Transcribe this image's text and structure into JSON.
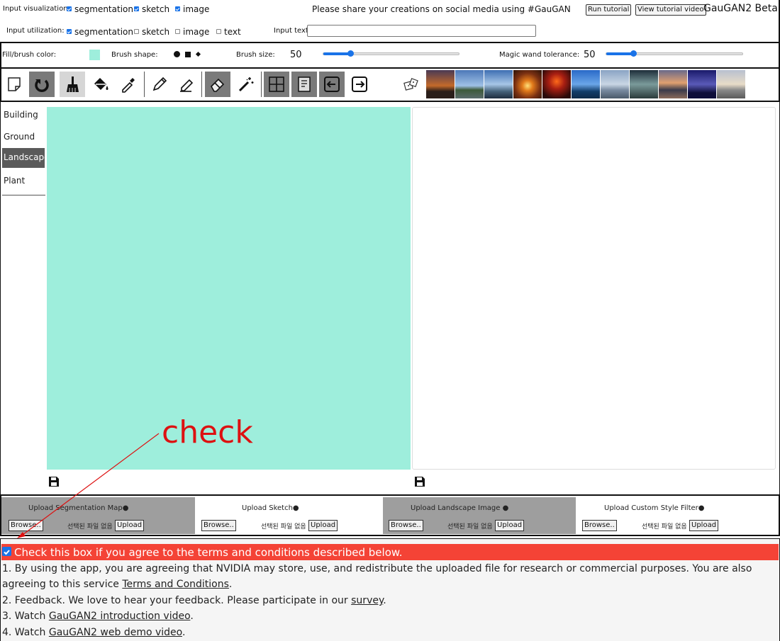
{
  "header": {
    "input_visualization_label": "Input visualization:",
    "visualization_options": [
      {
        "label": "segmentation",
        "checked": true
      },
      {
        "label": "sketch",
        "checked": true
      },
      {
        "label": "image",
        "checked": true
      }
    ],
    "input_utilization_label": "Input utilization:",
    "utilization_options": [
      {
        "label": "segmentation",
        "checked": true
      },
      {
        "label": "sketch",
        "checked": false
      },
      {
        "label": "image",
        "checked": false
      },
      {
        "label": "text",
        "checked": false
      }
    ],
    "share_text": "Please share your creations on social media using #GauGAN",
    "input_text_label": "Input text:",
    "input_text_value": "",
    "run_tutorial_label": "Run tutorial",
    "view_tutorial_label": "View tutorial video",
    "app_title": "GauGAN2 Beta"
  },
  "brush": {
    "fill_color_label": "Fill/brush color:",
    "fill_color": "#9eeedc",
    "shape_label": "Brush shape:",
    "shapes": [
      "circle",
      "square",
      "diamond"
    ],
    "size_label": "Brush size:",
    "size_value": "50",
    "size_fraction": 0.2,
    "wand_label": "Magic wand tolerance:",
    "wand_value": "50",
    "wand_fraction": 0.2
  },
  "toolbar": {
    "tools": [
      "new-page-icon",
      "undo-icon",
      "brush-icon",
      "fill-bucket-icon",
      "eyedropper-icon",
      "pencil-icon",
      "pencil-eraser-icon",
      "eraser-icon",
      "magic-wand-icon",
      "grid-icon",
      "notebook-icon",
      "arrow-left-icon",
      "arrow-right-icon",
      "dice-icon"
    ],
    "style_thumbnails": 11
  },
  "categories": [
    {
      "label": "Building",
      "active": false
    },
    {
      "label": "Ground",
      "active": false
    },
    {
      "label": "Landscape",
      "active": true
    },
    {
      "label": "Plant",
      "active": false
    }
  ],
  "canvas": {
    "left_fill": "#9eeedc"
  },
  "annotation": {
    "text": "check",
    "color": "#dd1111"
  },
  "uploads": [
    {
      "title": "Upload Segmentation Map",
      "browse": "Browse..",
      "no_file": "선택된 파일 없음",
      "upload": "Upload",
      "bg": "#9e9e9e"
    },
    {
      "title": "Upload Sketch",
      "browse": "Browse..",
      "no_file": "선택된 파일 없음",
      "upload": "Upload",
      "bg": "#ffffff"
    },
    {
      "title": "Upload Landscape Image",
      "browse": "Browse..",
      "no_file": "선택된 파일 없음",
      "upload": "Upload",
      "bg": "#9e9e9e"
    },
    {
      "title": "Upload Custom Style Filter",
      "browse": "Browse..",
      "no_file": "선택된 파일 없음",
      "upload": "Upload",
      "bg": "#ffffff"
    }
  ],
  "terms": {
    "agree_text": "Check this box if you agree to the terms and conditions described below.",
    "agree_checked": true,
    "p1_text": "1. By using the app, you are agreeing that NVIDIA may store, use, and redistribute the uploaded file for research or commercial purposes. You are also agreeing to this service",
    "p1_link": "Terms and Conditions",
    "p2_text": "2. Feedback. We love to hear your feedback. Please participate in our",
    "p2_link": "survey",
    "p3_text": "3. Watch",
    "p3_link": "GauGAN2 introduction video",
    "p4_text": "4. Watch",
    "p4_link": "GauGAN2 web demo video"
  }
}
